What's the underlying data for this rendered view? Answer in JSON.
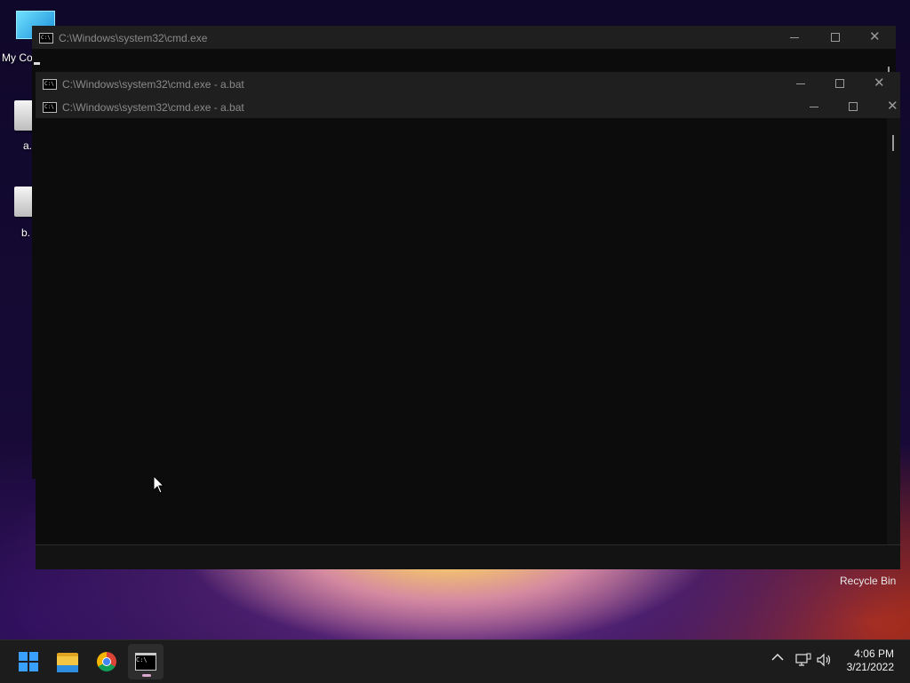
{
  "desktop": {
    "icons": [
      {
        "label": "My Co",
        "icon": "computer-icon"
      },
      {
        "label": "a.",
        "icon": "batch-file-icon"
      },
      {
        "label": "b.",
        "icon": "batch-file-icon"
      }
    ],
    "recycle_bin_label": "Recycle Bin"
  },
  "windows": {
    "back": {
      "title": "C:\\Windows\\system32\\cmd.exe",
      "app_icon_text": "C:\\"
    },
    "middle": {
      "title": "C:\\Windows\\system32\\cmd.exe - a.bat",
      "app_icon_text": "C:\\"
    },
    "front": {
      "title": "C:\\Windows\\system32\\cmd.exe - a.bat",
      "app_icon_text": "C:\\"
    }
  },
  "window_controls": {
    "minimize": "—",
    "maximize": "☐",
    "close": "✕"
  },
  "taskbar": {
    "apps": [
      {
        "name": "Start",
        "icon": "windows-start-icon"
      },
      {
        "name": "File Explorer",
        "icon": "folder-icon"
      },
      {
        "name": "Google Chrome",
        "icon": "chrome-icon"
      },
      {
        "name": "Command Prompt",
        "icon": "cmd-icon",
        "active": true
      }
    ],
    "tray": {
      "chevron": "^",
      "network_icon": "network-icon",
      "volume_icon": "volume-icon"
    },
    "clock": {
      "time": "4:06 PM",
      "date": "3/21/2022"
    }
  },
  "colors": {
    "console_bg": "#0c0c0c",
    "titlebar_bg": "#1f1f1f",
    "taskbar_bg": "#1c1c1c",
    "accent": "#3aa0ff"
  }
}
